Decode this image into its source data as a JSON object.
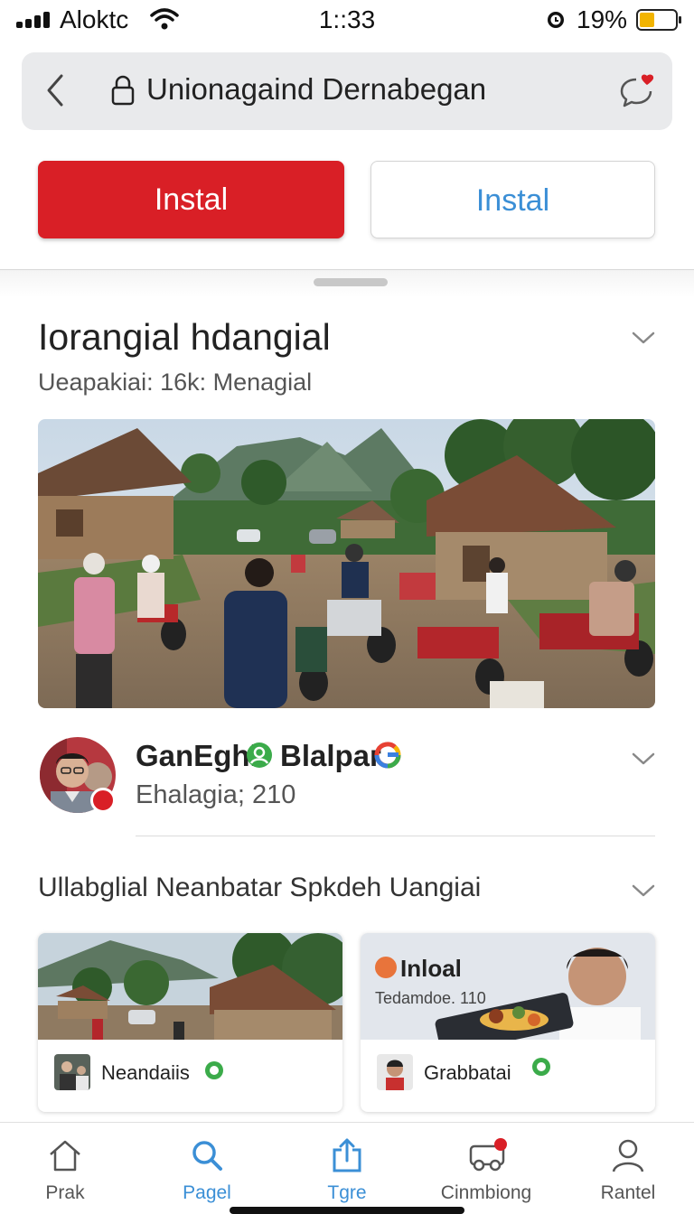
{
  "status_bar": {
    "carrier": "Aloktc",
    "time": "1::33",
    "battery_percent": "19%",
    "battery_level": 0.19,
    "icons": [
      "signal-icon",
      "wifi-icon",
      "alarm-icon",
      "battery-icon"
    ]
  },
  "url_bar": {
    "text": "Unionagaind Dernabegan",
    "icons": [
      "back-chevron-icon",
      "lock-icon",
      "chat-icon"
    ]
  },
  "actions": {
    "primary_label": "Instal",
    "secondary_label": "Instal"
  },
  "article": {
    "title": "Iorangial hdangial",
    "meta": "Ueapakiai: 16k: Menagial"
  },
  "author": {
    "name_part1": "GanEghl",
    "name_part2": "Blalpar",
    "subtitle": "Ehalagia; 210"
  },
  "related": {
    "title": "Ullabglial Neanbatar Spkdeh Uangiai",
    "cards": [
      {
        "label": "Neandaiis"
      },
      {
        "title": "Inloal",
        "subtitle": "Tedamdoe. 110",
        "label": "Grabbatai"
      }
    ]
  },
  "bottom_nav": {
    "items": [
      {
        "label": "Prak",
        "icon": "home-icon"
      },
      {
        "label": "Pagel",
        "icon": "search-icon"
      },
      {
        "label": "Tgre",
        "icon": "share-icon"
      },
      {
        "label": "Cinmbiong",
        "icon": "car-icon"
      },
      {
        "label": "Rantel",
        "icon": "person-icon"
      }
    ]
  },
  "colors": {
    "primary_button": "#d91f26",
    "accent_blue": "#3b8fd6",
    "url_bar_bg": "#e9eaec",
    "verify_green": "#3bab4a"
  }
}
